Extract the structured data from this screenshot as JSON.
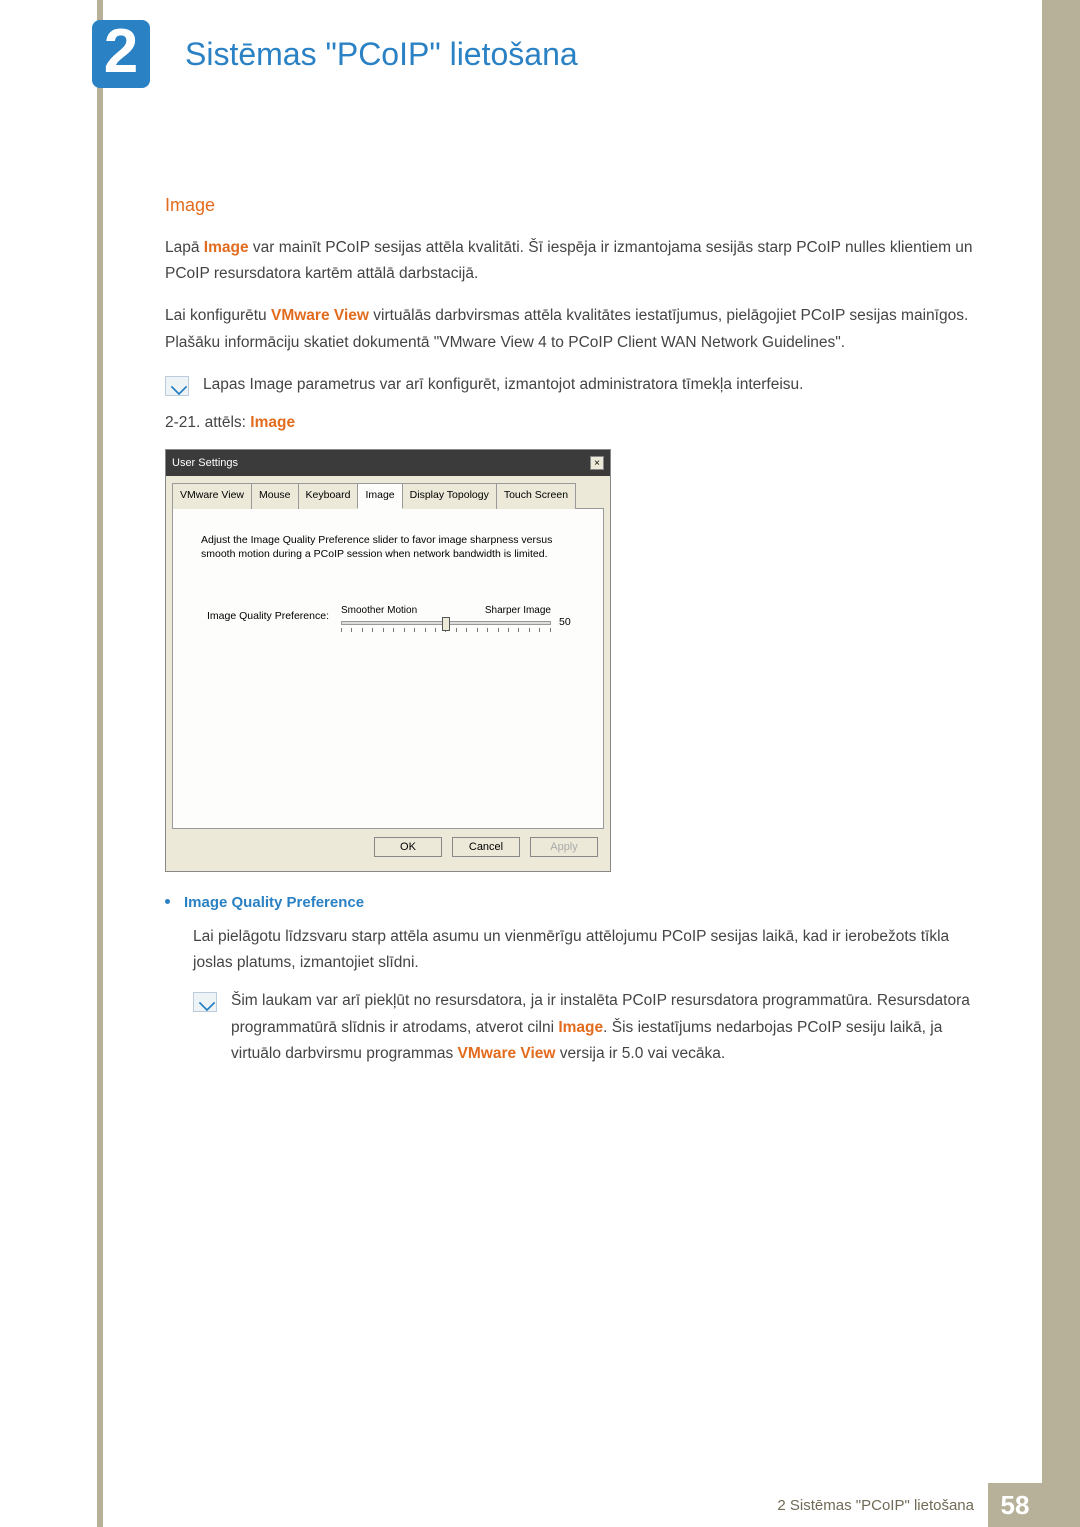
{
  "chapter": {
    "number": "2",
    "title": "Sistēmas \"PCoIP\" lietošana"
  },
  "section": {
    "heading": "Image",
    "p1a": "Lapā ",
    "p1b": "Image",
    "p1c": " var mainīt PCoIP sesijas attēla kvalitāti. Šī iespēja ir izmantojama sesijās starp PCoIP nulles klientiem un PCoIP resursdatora kartēm attālā darbstacijā.",
    "p2a": "Lai konfigurētu ",
    "p2b": "VMware View",
    "p2c": " virtuālās darbvirsmas attēla kvalitātes iestatījumus, pielāgojiet PCoIP sesijas mainīgos. Plašāku informāciju skatiet dokumentā \"VMware View 4 to PCoIP Client WAN Network Guidelines\".",
    "note1": "Lapas Image parametrus var arī konfigurēt, izmantojot administratora tīmekļa interfeisu.",
    "fig_prefix": "2-21. attēls: ",
    "fig_name": "Image"
  },
  "dialog": {
    "title": "User Settings",
    "tabs": [
      "VMware View",
      "Mouse",
      "Keyboard",
      "Image",
      "Display Topology",
      "Touch Screen"
    ],
    "active_tab": 3,
    "help": "Adjust the Image Quality Preference slider to favor image sharpness versus smooth motion during a PCoIP session when network bandwidth is limited.",
    "slider": {
      "label": "Image Quality Preference:",
      "left": "Smoother Motion",
      "right": "Sharper Image",
      "value": "50"
    },
    "buttons": {
      "ok": "OK",
      "cancel": "Cancel",
      "apply": "Apply"
    }
  },
  "bullet": {
    "title": "Image Quality Preference",
    "body": "Lai pielāgotu līdzsvaru starp attēla asumu un vienmērīgu attēlojumu PCoIP sesijas laikā, kad ir ierobežots tīkla joslas platums, izmantojiet slīdni.",
    "note_a": "Šim laukam var arī piekļūt no resursdatora, ja ir instalēta PCoIP resursdatora programmatūra. Resursdatora programmatūrā slīdnis ir atrodams, atverot cilni ",
    "note_b": "Image",
    "note_c": ". Šis iestatījums nedarbojas PCoIP sesiju laikā, ja virtuālo darbvirsmu programmas ",
    "note_d": "VMware View",
    "note_e": " versija ir 5.0 vai vecāka."
  },
  "footer": {
    "label": "2 Sistēmas \"PCoIP\" lietošana",
    "page": "58"
  }
}
